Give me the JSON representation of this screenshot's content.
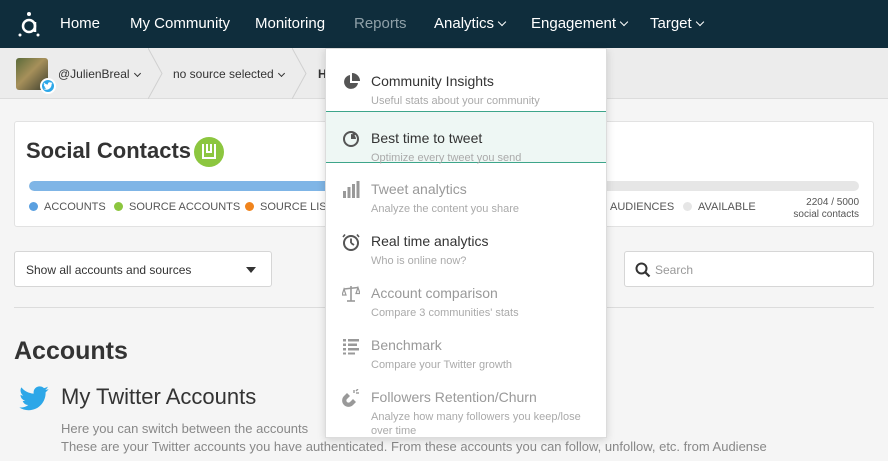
{
  "nav": {
    "items": [
      {
        "label": "Home",
        "dropdown": false,
        "dim": false
      },
      {
        "label": "My Community",
        "dropdown": false,
        "dim": false
      },
      {
        "label": "Monitoring",
        "dropdown": false,
        "dim": false
      },
      {
        "label": "Reports",
        "dropdown": false,
        "dim": true
      },
      {
        "label": "Analytics",
        "dropdown": true,
        "dim": false
      },
      {
        "label": "Engagement",
        "dropdown": true,
        "dim": false
      },
      {
        "label": "Target",
        "dropdown": true,
        "dim": false
      }
    ]
  },
  "breadcrumb": {
    "user": "@JulienBreal",
    "source": "no source selected",
    "current": "H"
  },
  "social_contacts": {
    "title": "Social Contacts",
    "progress_fraction": 0.441,
    "legend": [
      {
        "label": "ACCOUNTS",
        "color": "#5aa0e0"
      },
      {
        "label": "SOURCE ACCOUNTS",
        "color": "#8cc63f"
      },
      {
        "label": "SOURCE LIST",
        "color": "#f0841d"
      },
      {
        "label": "AUDIENCES",
        "color": "#e6e6e6"
      },
      {
        "label": "AVAILABLE",
        "color": "#e6e6e6"
      }
    ],
    "count": "2204 / 5000",
    "count_label": "social contacts"
  },
  "filters": {
    "select_value": "Show all accounts and sources",
    "search_placeholder": "Search"
  },
  "accounts": {
    "title": "Accounts",
    "twitter_title": "My Twitter Accounts",
    "line1": "Here you can switch between the accounts",
    "line2": "These are your Twitter accounts you have authenticated. From these accounts you can follow, unfollow, etc. from Audiense"
  },
  "menu": {
    "items": [
      {
        "title": "Community Insights",
        "sub": "Useful stats about your community",
        "icon": "pie-chart-icon",
        "enabled": true,
        "active": false
      },
      {
        "title": "Best time to tweet",
        "sub": "Optimize every tweet you send",
        "icon": "clock-chart-icon",
        "enabled": true,
        "active": true
      },
      {
        "title": "Tweet analytics",
        "sub": "Analyze the content you share",
        "icon": "bar-chart-icon",
        "enabled": false,
        "active": false
      },
      {
        "title": "Real time analytics",
        "sub": "Who is online now?",
        "icon": "realtime-clock-icon",
        "enabled": true,
        "active": false
      },
      {
        "title": "Account comparison",
        "sub": "Compare 3 communities' stats",
        "icon": "scale-icon",
        "enabled": false,
        "active": false
      },
      {
        "title": "Benchmark",
        "sub": "Compare your Twitter growth",
        "icon": "list-icon",
        "enabled": false,
        "active": false
      },
      {
        "title": "Followers Retention/Churn",
        "sub": "Analyze how many followers you keep/lose",
        "sub2": "over time",
        "icon": "magnet-icon",
        "enabled": false,
        "active": false
      }
    ]
  }
}
